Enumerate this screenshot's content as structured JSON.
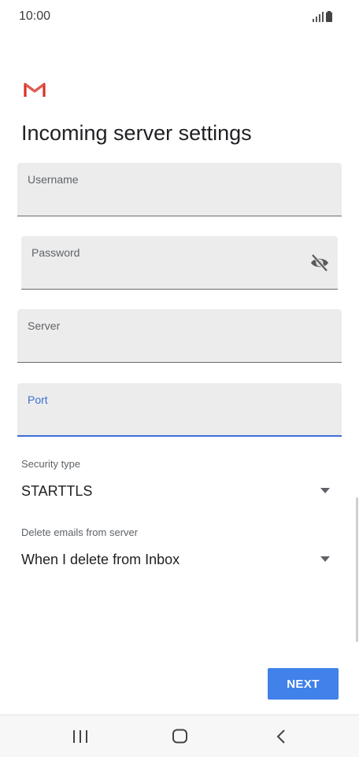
{
  "status_bar": {
    "time": "10:00",
    "icons": [
      "signal-icon",
      "battery-icon"
    ]
  },
  "app": {
    "logo": "gmail-logo-icon",
    "brand_color": "#d93025"
  },
  "page": {
    "title": "Incoming server settings"
  },
  "form": {
    "username": {
      "label": "Username",
      "value": ""
    },
    "password": {
      "label": "Password",
      "value": "",
      "toggle_icon": "visibility-off-icon"
    },
    "server": {
      "label": "Server",
      "value": ""
    },
    "port": {
      "label": "Port",
      "value": "",
      "focused": true
    }
  },
  "security": {
    "label": "Security type",
    "selected": "STARTTLS"
  },
  "delete_emails": {
    "label": "Delete emails from server",
    "selected": "When I delete from Inbox"
  },
  "actions": {
    "next_label": "NEXT",
    "accent_color": "#4081ea"
  },
  "nav_bar": {
    "items": [
      "recent-apps-icon",
      "home-icon",
      "back-icon"
    ]
  }
}
